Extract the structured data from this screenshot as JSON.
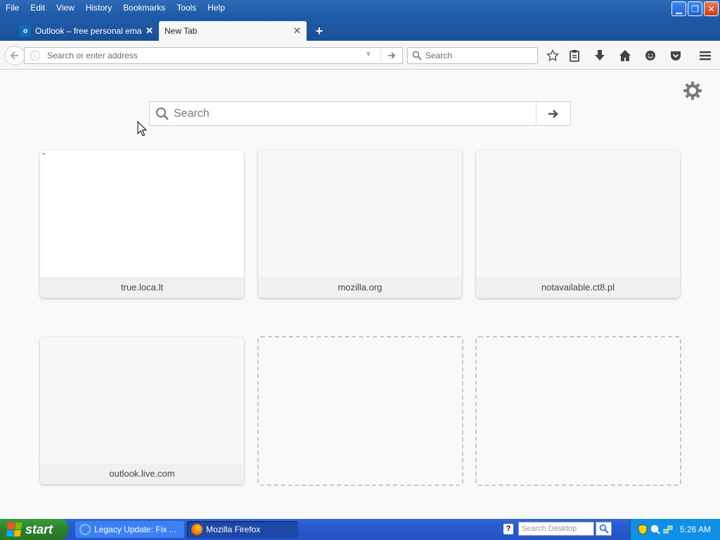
{
  "menubar": {
    "items": [
      {
        "label": "File",
        "key": "F"
      },
      {
        "label": "Edit",
        "key": "E"
      },
      {
        "label": "View",
        "key": "V"
      },
      {
        "label": "History",
        "key": "s"
      },
      {
        "label": "Bookmarks",
        "key": "B"
      },
      {
        "label": "Tools",
        "key": "T"
      },
      {
        "label": "Help",
        "key": "H"
      }
    ]
  },
  "tabs": [
    {
      "label": "Outlook – free personal email a...",
      "favicon": "o"
    },
    {
      "label": "New Tab"
    }
  ],
  "navbar": {
    "url_placeholder": "Search or enter address",
    "search_placeholder": "Search"
  },
  "content": {
    "search_placeholder": "Search"
  },
  "tiles": [
    {
      "title": "true.loca.lt",
      "empty": false
    },
    {
      "title": "mozilla.org",
      "empty": false
    },
    {
      "title": "notavailable.ct8.pl",
      "empty": false
    },
    {
      "title": "outlook.live.com",
      "empty": false
    },
    {
      "title": "",
      "empty": true
    },
    {
      "title": "",
      "empty": true
    }
  ],
  "taskbar": {
    "start_label": "start",
    "tasks": [
      {
        "label": "Legacy Update: Fix ..."
      },
      {
        "label": "Mozilla Firefox"
      }
    ],
    "desktop_search_placeholder": "Search Desktop",
    "clock": "5:26 AM"
  },
  "colors": {
    "titlebar": "#1f5aa6",
    "taskbar": "#2a5ccf",
    "start_button": "#2a7e2a",
    "tray": "#0f8fe6"
  }
}
